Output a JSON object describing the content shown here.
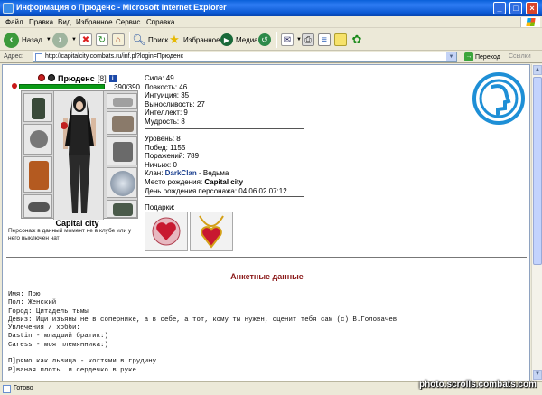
{
  "window": {
    "title": "Информация о Прюденс - Microsoft Internet Explorer",
    "minimize": "_",
    "maximize": "□",
    "close": "×"
  },
  "menu": [
    "Файл",
    "Правка",
    "Вид",
    "Избранное",
    "Сервис",
    "Справка"
  ],
  "toolbar": {
    "back": "Назад",
    "search": "Поиск",
    "favorites": "Избранное",
    "media": "Медиа"
  },
  "address": {
    "label": "Адрес:",
    "url": "http://capitalcity.combats.ru/inf.pl?login=Прюденс",
    "go": "Переход",
    "links": "Ссылки"
  },
  "character": {
    "name": "Прюденс",
    "level": "[8]",
    "info_icon": "i",
    "hp": "390/390",
    "city": "Capital city",
    "chat_note": "Персонаж в данный момент не в клубе или у него выключен чат"
  },
  "stats": {
    "strength": "Сила: 49",
    "agility": "Ловкость: 46",
    "intuition": "Интуиция: 35",
    "endurance": "Выносливость: 27",
    "intellect": "Интеллект: 9",
    "wisdom": "Мудрость: 8"
  },
  "info": {
    "level": "Уровень: 8",
    "wins": "Побед: 1155",
    "losses": "Поражений: 789",
    "draws": "Ничьих: 0",
    "clan_label": "Клан: ",
    "clan_name": "DarkClan",
    "clan_role": " - Ведьма",
    "birthplace_label": "Место рождения: ",
    "birthplace": "Capital city",
    "birthday": "День рождения персонажа: 04.06.02 07:12",
    "gifts_label": "Подарки:"
  },
  "profile": {
    "section_title": "Анкетные данные",
    "name": "Имя: Прю",
    "gender": "Пол: Женский",
    "town": "Город: Цитадель тьмы",
    "motto": "Девиз: Ищи изъяны не в сопернике, а в себе, а тот, кому ты нужен, оценит тебя сам (с) В.Головачев",
    "hobby_label": "Увлечения / хобби:",
    "line1": "Dastin - младший братик:)",
    "line2": "Caress - моя племянника:)",
    "line3": "П]рямо как львица - когтями в грудину",
    "line4": "Р]ваная плоть  и сердечко в руке"
  },
  "status": {
    "text": "Готово"
  },
  "watermark": "photo.scrolls.combats.com",
  "colors": {
    "hp_bar": "#0a9a16",
    "section_title": "#8b1a1a",
    "clan_link": "#1a3f8f",
    "title_bar": "#0a5fd8"
  }
}
